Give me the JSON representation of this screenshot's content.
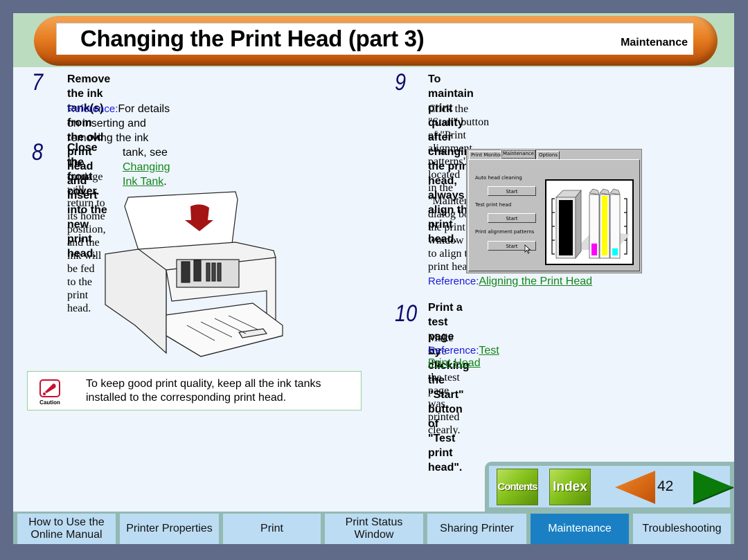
{
  "header": {
    "title": "Changing the Print Head (part 3)",
    "section": "Maintenance"
  },
  "steps": [
    {
      "number": "7",
      "heading_line1": "Remove the ink tank(s) from the old print head and",
      "heading_line2": "insert into the new print head.",
      "reference_label": "Reference:",
      "reference_text_line1": "For details on inserting and removing the ink",
      "reference_text_line2_prefix": "tank, see ",
      "reference_link": "Changing Ink Tank",
      "reference_text_line2_suffix": "."
    },
    {
      "number": "8",
      "heading": "Close the front cover.",
      "body_line1": "The carriage will return to its home position, and the ink will",
      "body_line2": "be fed to the print head."
    },
    {
      "number": "9",
      "heading_line1": "To maintain print quality after changing the print",
      "heading_line2": "head, always align the print head.",
      "body_line1": "Click the \"Start\" button of \"Print alignment patterns\" located",
      "body_line2": "in the \"Maintenance\" dialog box of the print status window",
      "body_line3": "to align the print head.",
      "reference_label": "Reference:",
      "reference_link": "Aligning the Print Head"
    },
    {
      "number": "10",
      "heading_line1": "Print a test page by clicking the \"Start\" button of",
      "heading_line2": "\"Test print head\".",
      "body": "Make sure that the test page was printed clearly.",
      "reference_label": "Reference:",
      "reference_link": "Test Print Head"
    }
  ],
  "caution": {
    "icon_label": "Caution",
    "text_line1": "To keep good print quality, keep all the ink tanks",
    "text_line2": "installed to the corresponding print head."
  },
  "dialog": {
    "tabs": [
      "Print Monitor",
      "Maintenance",
      "Options"
    ],
    "active_tab": "Maintenance",
    "items": [
      {
        "label": "Auto head cleaning",
        "button": "Start"
      },
      {
        "label": "Test print head",
        "button": "Start"
      },
      {
        "label": "Print alignment patterns",
        "button": "Start"
      }
    ],
    "ink_levels": {
      "black": 1.0,
      "magenta": 0.2,
      "yellow": 1.0,
      "cyan": 0.12
    },
    "ink_colors": {
      "black": "#000000",
      "magenta": "#ff00ff",
      "yellow": "#ffff00",
      "cyan": "#00ffff"
    }
  },
  "nav": {
    "contents_label": "Contents",
    "index_label": "Index",
    "page_number": "42",
    "prev_color": "#e0660a",
    "next_color": "#0a7a0a"
  },
  "tabs": [
    {
      "label_line1": "How to Use the",
      "label_line2": "Online Manual",
      "active": false
    },
    {
      "label_line1": "Printer Properties",
      "label_line2": "",
      "active": false
    },
    {
      "label_line1": "Print",
      "label_line2": "",
      "active": false
    },
    {
      "label_line1": "Print Status",
      "label_line2": "Window",
      "active": false
    },
    {
      "label_line1": "Sharing Printer",
      "label_line2": "",
      "active": false
    },
    {
      "label_line1": "Maintenance",
      "label_line2": "",
      "active": true
    },
    {
      "label_line1": "Troubleshooting",
      "label_line2": "",
      "active": false
    }
  ],
  "colors": {
    "accent_orange": "#e77e22",
    "active_tab": "#1a80c3",
    "link_green": "#13851a",
    "reference_blue": "#1a1adc"
  }
}
